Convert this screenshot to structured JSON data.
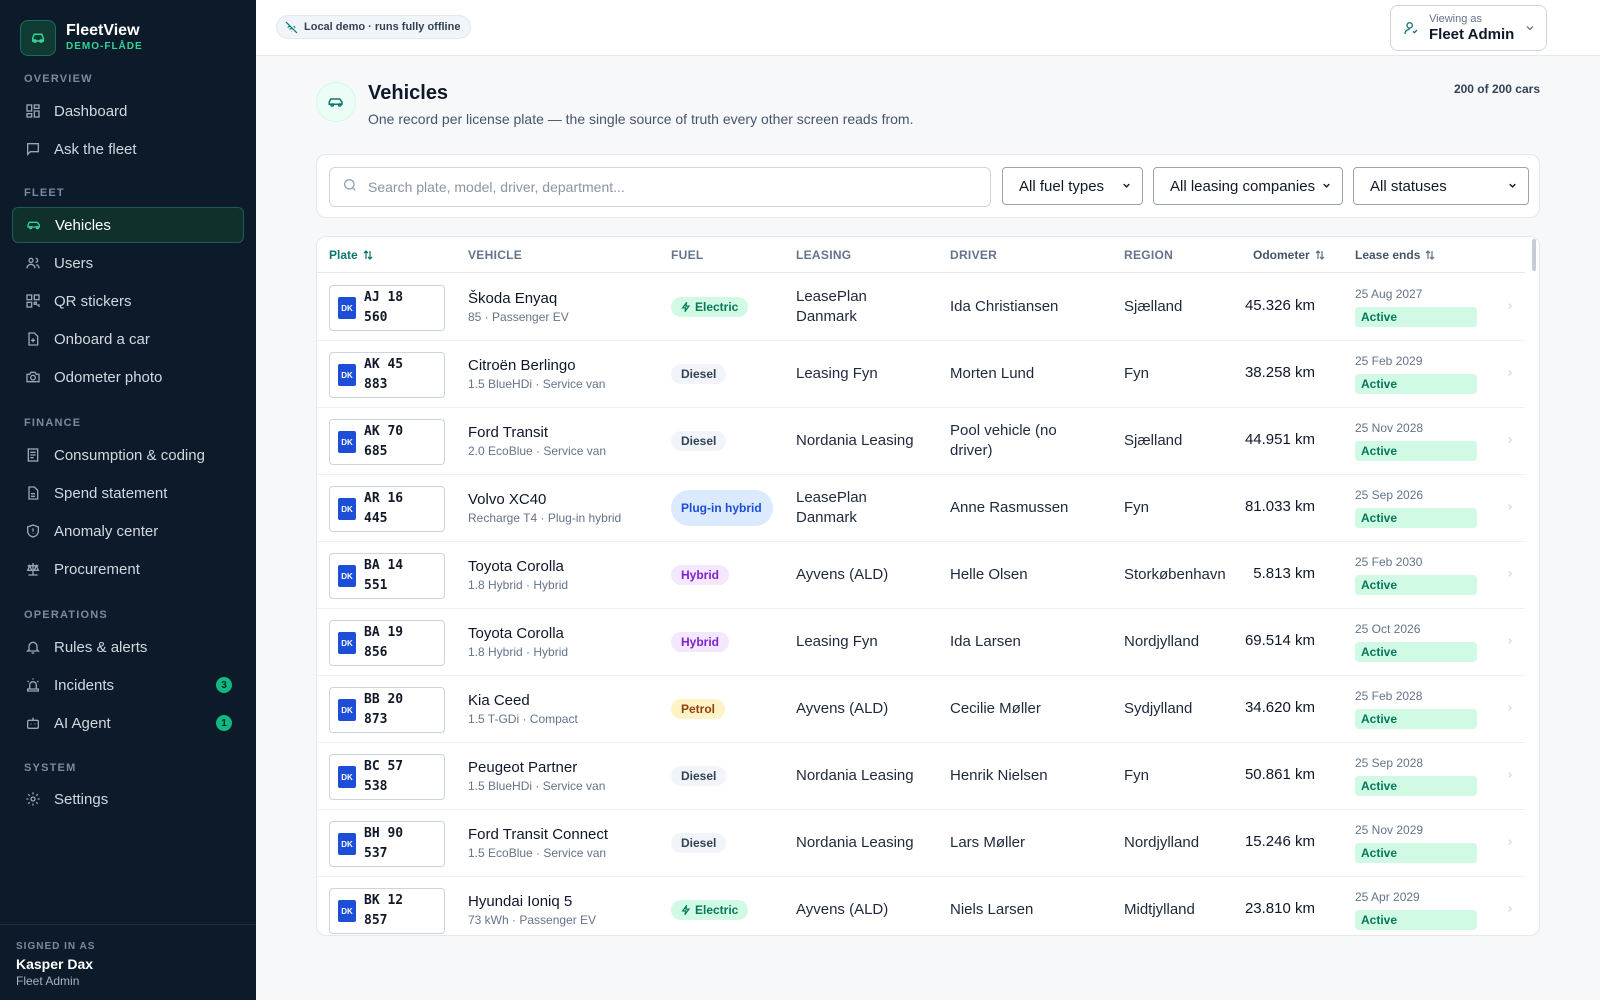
{
  "brand": {
    "name": "FleetView",
    "sub": "DEMO-FLÅDE"
  },
  "nav": {
    "sections": [
      {
        "label": "OVERVIEW",
        "items": [
          {
            "label": "Dashboard",
            "icon": "dashboard-icon"
          },
          {
            "label": "Ask the fleet",
            "icon": "chat-icon"
          }
        ]
      },
      {
        "label": "FLEET",
        "items": [
          {
            "label": "Vehicles",
            "icon": "car-icon",
            "active": true
          },
          {
            "label": "Users",
            "icon": "users-icon"
          },
          {
            "label": "QR stickers",
            "icon": "qr-icon"
          },
          {
            "label": "Onboard a car",
            "icon": "file-plus-icon"
          },
          {
            "label": "Odometer photo",
            "icon": "camera-icon"
          }
        ]
      },
      {
        "label": "FINANCE",
        "items": [
          {
            "label": "Consumption & coding",
            "icon": "document-icon"
          },
          {
            "label": "Spend statement",
            "icon": "receipt-icon"
          },
          {
            "label": "Anomaly center",
            "icon": "shield-icon"
          },
          {
            "label": "Procurement",
            "icon": "scale-icon"
          }
        ]
      },
      {
        "label": "OPERATIONS",
        "items": [
          {
            "label": "Rules & alerts",
            "icon": "bell-icon"
          },
          {
            "label": "Incidents",
            "icon": "siren-icon",
            "badge": "3"
          },
          {
            "label": "AI Agent",
            "icon": "bot-icon",
            "badge": "1"
          }
        ]
      },
      {
        "label": "SYSTEM",
        "items": [
          {
            "label": "Settings",
            "icon": "gear-icon"
          }
        ]
      }
    ]
  },
  "footer": {
    "label": "SIGNED IN AS",
    "name": "Kasper Dax",
    "role": "Fleet Admin"
  },
  "topbar": {
    "chip": "Local demo · runs fully offline",
    "viewing_label": "Viewing as",
    "viewing_value": "Fleet Admin"
  },
  "page": {
    "title": "Vehicles",
    "subtitle": "One record per license plate — the single source of truth every other screen reads from.",
    "count": "200 of 200 cars"
  },
  "filters": {
    "search_placeholder": "Search plate, model, driver, department...",
    "fuel": "All fuel types",
    "leasing": "All leasing companies",
    "status": "All statuses"
  },
  "table": {
    "headers": {
      "plate": "Plate",
      "vehicle": "VEHICLE",
      "fuel": "FUEL",
      "leasing": "LEASING",
      "driver": "DRIVER",
      "region": "REGION",
      "odometer": "Odometer",
      "lease": "Lease ends"
    },
    "rows": [
      {
        "plate": "AJ 18 560",
        "country": "DK",
        "model": "Škoda Enyaq",
        "spec": "85 · Passenger EV",
        "fuel": "Electric",
        "fuel_kind": "electric",
        "leasing": "LeasePlan Danmark",
        "driver": "Ida Christiansen",
        "region": "Sjælland",
        "odometer": "45.326 km",
        "lease_end": "25 Aug 2027",
        "status": "Active"
      },
      {
        "plate": "AK 45 883",
        "country": "DK",
        "model": "Citroën Berlingo",
        "spec": "1.5 BlueHDi · Service van",
        "fuel": "Diesel",
        "fuel_kind": "diesel",
        "leasing": "Leasing Fyn",
        "driver": "Morten Lund",
        "region": "Fyn",
        "odometer": "38.258 km",
        "lease_end": "25 Feb 2029",
        "status": "Active"
      },
      {
        "plate": "AK 70 685",
        "country": "DK",
        "model": "Ford Transit",
        "spec": "2.0 EcoBlue · Service van",
        "fuel": "Diesel",
        "fuel_kind": "diesel",
        "leasing": "Nordania Leasing",
        "driver": "Pool vehicle (no driver)",
        "region": "Sjælland",
        "odometer": "44.951 km",
        "lease_end": "25 Nov 2028",
        "status": "Active"
      },
      {
        "plate": "AR 16 445",
        "country": "DK",
        "model": "Volvo XC40",
        "spec": "Recharge T4 · Plug-in hybrid",
        "fuel": "Plug-in hybrid",
        "fuel_kind": "plugin",
        "leasing": "LeasePlan Danmark",
        "driver": "Anne Rasmussen",
        "region": "Fyn",
        "odometer": "81.033 km",
        "lease_end": "25 Sep 2026",
        "status": "Active"
      },
      {
        "plate": "BA 14 551",
        "country": "DK",
        "model": "Toyota Corolla",
        "spec": "1.8 Hybrid · Hybrid",
        "fuel": "Hybrid",
        "fuel_kind": "hybrid",
        "leasing": "Ayvens (ALD)",
        "driver": "Helle Olsen",
        "region": "Storkøbenhavn",
        "odometer": "5.813 km",
        "lease_end": "25 Feb 2030",
        "status": "Active"
      },
      {
        "plate": "BA 19 856",
        "country": "DK",
        "model": "Toyota Corolla",
        "spec": "1.8 Hybrid · Hybrid",
        "fuel": "Hybrid",
        "fuel_kind": "hybrid",
        "leasing": "Leasing Fyn",
        "driver": "Ida Larsen",
        "region": "Nordjylland",
        "odometer": "69.514 km",
        "lease_end": "25 Oct 2026",
        "status": "Active"
      },
      {
        "plate": "BB 20 873",
        "country": "DK",
        "model": "Kia Ceed",
        "spec": "1.5 T-GDi · Compact",
        "fuel": "Petrol",
        "fuel_kind": "petrol",
        "leasing": "Ayvens (ALD)",
        "driver": "Cecilie Møller",
        "region": "Sydjylland",
        "odometer": "34.620 km",
        "lease_end": "25 Feb 2028",
        "status": "Active"
      },
      {
        "plate": "BC 57 538",
        "country": "DK",
        "model": "Peugeot Partner",
        "spec": "1.5 BlueHDi · Service van",
        "fuel": "Diesel",
        "fuel_kind": "diesel",
        "leasing": "Nordania Leasing",
        "driver": "Henrik Nielsen",
        "region": "Fyn",
        "odometer": "50.861 km",
        "lease_end": "25 Sep 2028",
        "status": "Active"
      },
      {
        "plate": "BH 90 537",
        "country": "DK",
        "model": "Ford Transit Connect",
        "spec": "1.5 EcoBlue · Service van",
        "fuel": "Diesel",
        "fuel_kind": "diesel",
        "leasing": "Nordania Leasing",
        "driver": "Lars Møller",
        "region": "Nordjylland",
        "odometer": "15.246 km",
        "lease_end": "25 Nov 2029",
        "status": "Active"
      },
      {
        "plate": "BK 12 857",
        "country": "DK",
        "model": "Hyundai Ioniq 5",
        "spec": "73 kWh · Passenger EV",
        "fuel": "Electric",
        "fuel_kind": "electric",
        "leasing": "Ayvens (ALD)",
        "driver": "Niels Larsen",
        "region": "Midtjylland",
        "odometer": "23.810 km",
        "lease_end": "25 Apr 2029",
        "status": "Active"
      }
    ]
  },
  "colors": {
    "accent": "#10b981",
    "sidebar": "#0c1a29",
    "plate_blue": "#1d4ed8"
  }
}
